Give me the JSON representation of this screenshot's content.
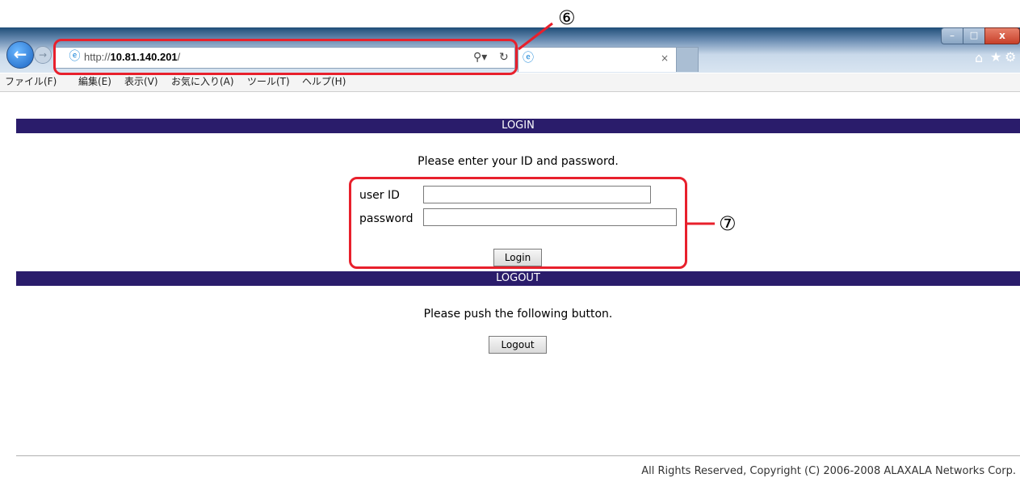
{
  "browser": {
    "url_prefix": "http://",
    "url_host": "10.81.140.201",
    "url_suffix": "/",
    "tab_close": "×",
    "icons": [
      "back-arrow-icon",
      "forward-arrow-icon",
      "ie-favicon-icon",
      "search-icon",
      "refresh-icon",
      "home-icon",
      "star-icon",
      "gear-icon"
    ],
    "window_buttons": {
      "minimize": "–",
      "maximize": "□",
      "close": "x"
    }
  },
  "menu": {
    "items": [
      "ファイル(F)",
      "編集(E)",
      "表示(V)",
      "お気に入り(A)",
      "ツール(T)",
      "ヘルプ(H)"
    ]
  },
  "login": {
    "title": "LOGIN",
    "instruction": "Please enter your ID and password.",
    "user_id_label": "user ID",
    "password_label": "password",
    "user_id_value": "",
    "password_value": "",
    "button": "Login"
  },
  "logout": {
    "title": "LOGOUT",
    "instruction": "Please push the following button.",
    "button": "Logout"
  },
  "annotations": {
    "address_marker": "⑥",
    "login_marker": "⑦",
    "color": "#e8202c"
  },
  "footer": {
    "copyright": "All Rights Reserved, Copyright (C) 2006-2008 ALAXALA Networks Corp."
  }
}
